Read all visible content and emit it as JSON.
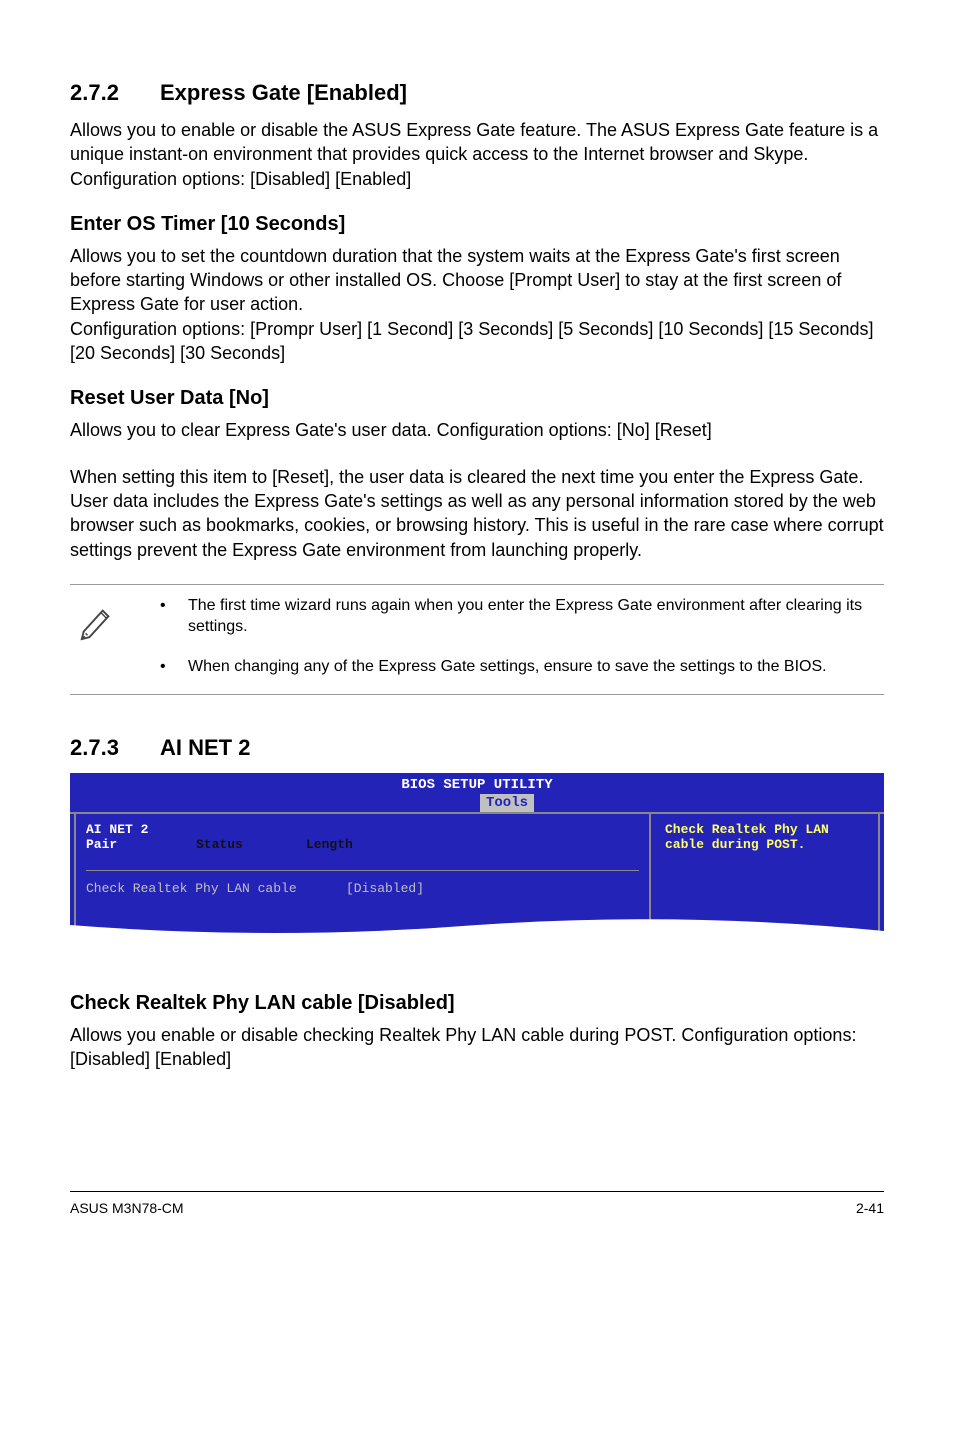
{
  "section272": {
    "number": "2.7.2",
    "title": "Express Gate [Enabled]",
    "intro": "Allows you to enable or disable the ASUS Express Gate feature. The ASUS Express Gate feature is a unique instant-on environment that provides quick access to the Internet browser and Skype. Configuration options: [Disabled] [Enabled]",
    "sub1_title": "Enter OS Timer [10 Seconds]",
    "sub1_body": "Allows you to set the countdown duration that the system waits at the Express Gate's first screen before starting Windows or other installed OS. Choose [Prompt User] to stay at the first screen of Express Gate for user action.\nConfiguration options: [Prompr User] [1 Second] [3 Seconds] [5 Seconds] [10 Seconds] [15 Seconds] [20 Seconds] [30 Seconds]",
    "sub2_title": "Reset User Data [No]",
    "sub2_body1": "Allows you to clear Express Gate's user data. Configuration options: [No] [Reset]",
    "sub2_body2": "When setting this item to [Reset], the user data is cleared the next time you enter the Express Gate. User data includes the Express Gate's settings as well as any personal information stored by the web browser such as bookmarks, cookies, or browsing history. This is useful in the rare case where corrupt settings prevent the Express Gate environment from launching properly.",
    "note1": "The first time wizard runs again when you enter the Express Gate environment after clearing its settings.",
    "note2": "When changing any of the Express Gate settings, ensure to save the settings to the BIOS."
  },
  "section273": {
    "number": "2.7.3",
    "title": "AI NET 2"
  },
  "bios": {
    "header": "BIOS SETUP UTILITY",
    "tab": "Tools",
    "col_ai": "AI NET 2",
    "col_pair": "Pair",
    "col_status": "Status",
    "col_length": "Length",
    "item_label": "Check Realtek Phy LAN cable",
    "item_value": "[Disabled]",
    "help": "Check Realtek Phy LAN cable during POST."
  },
  "check_section": {
    "title": "Check Realtek Phy LAN cable [Disabled]",
    "body": "Allows you enable or disable checking Realtek Phy LAN cable during POST. Configuration options: [Disabled] [Enabled]"
  },
  "footer": {
    "left": "ASUS M3N78-CM",
    "right": "2-41"
  }
}
